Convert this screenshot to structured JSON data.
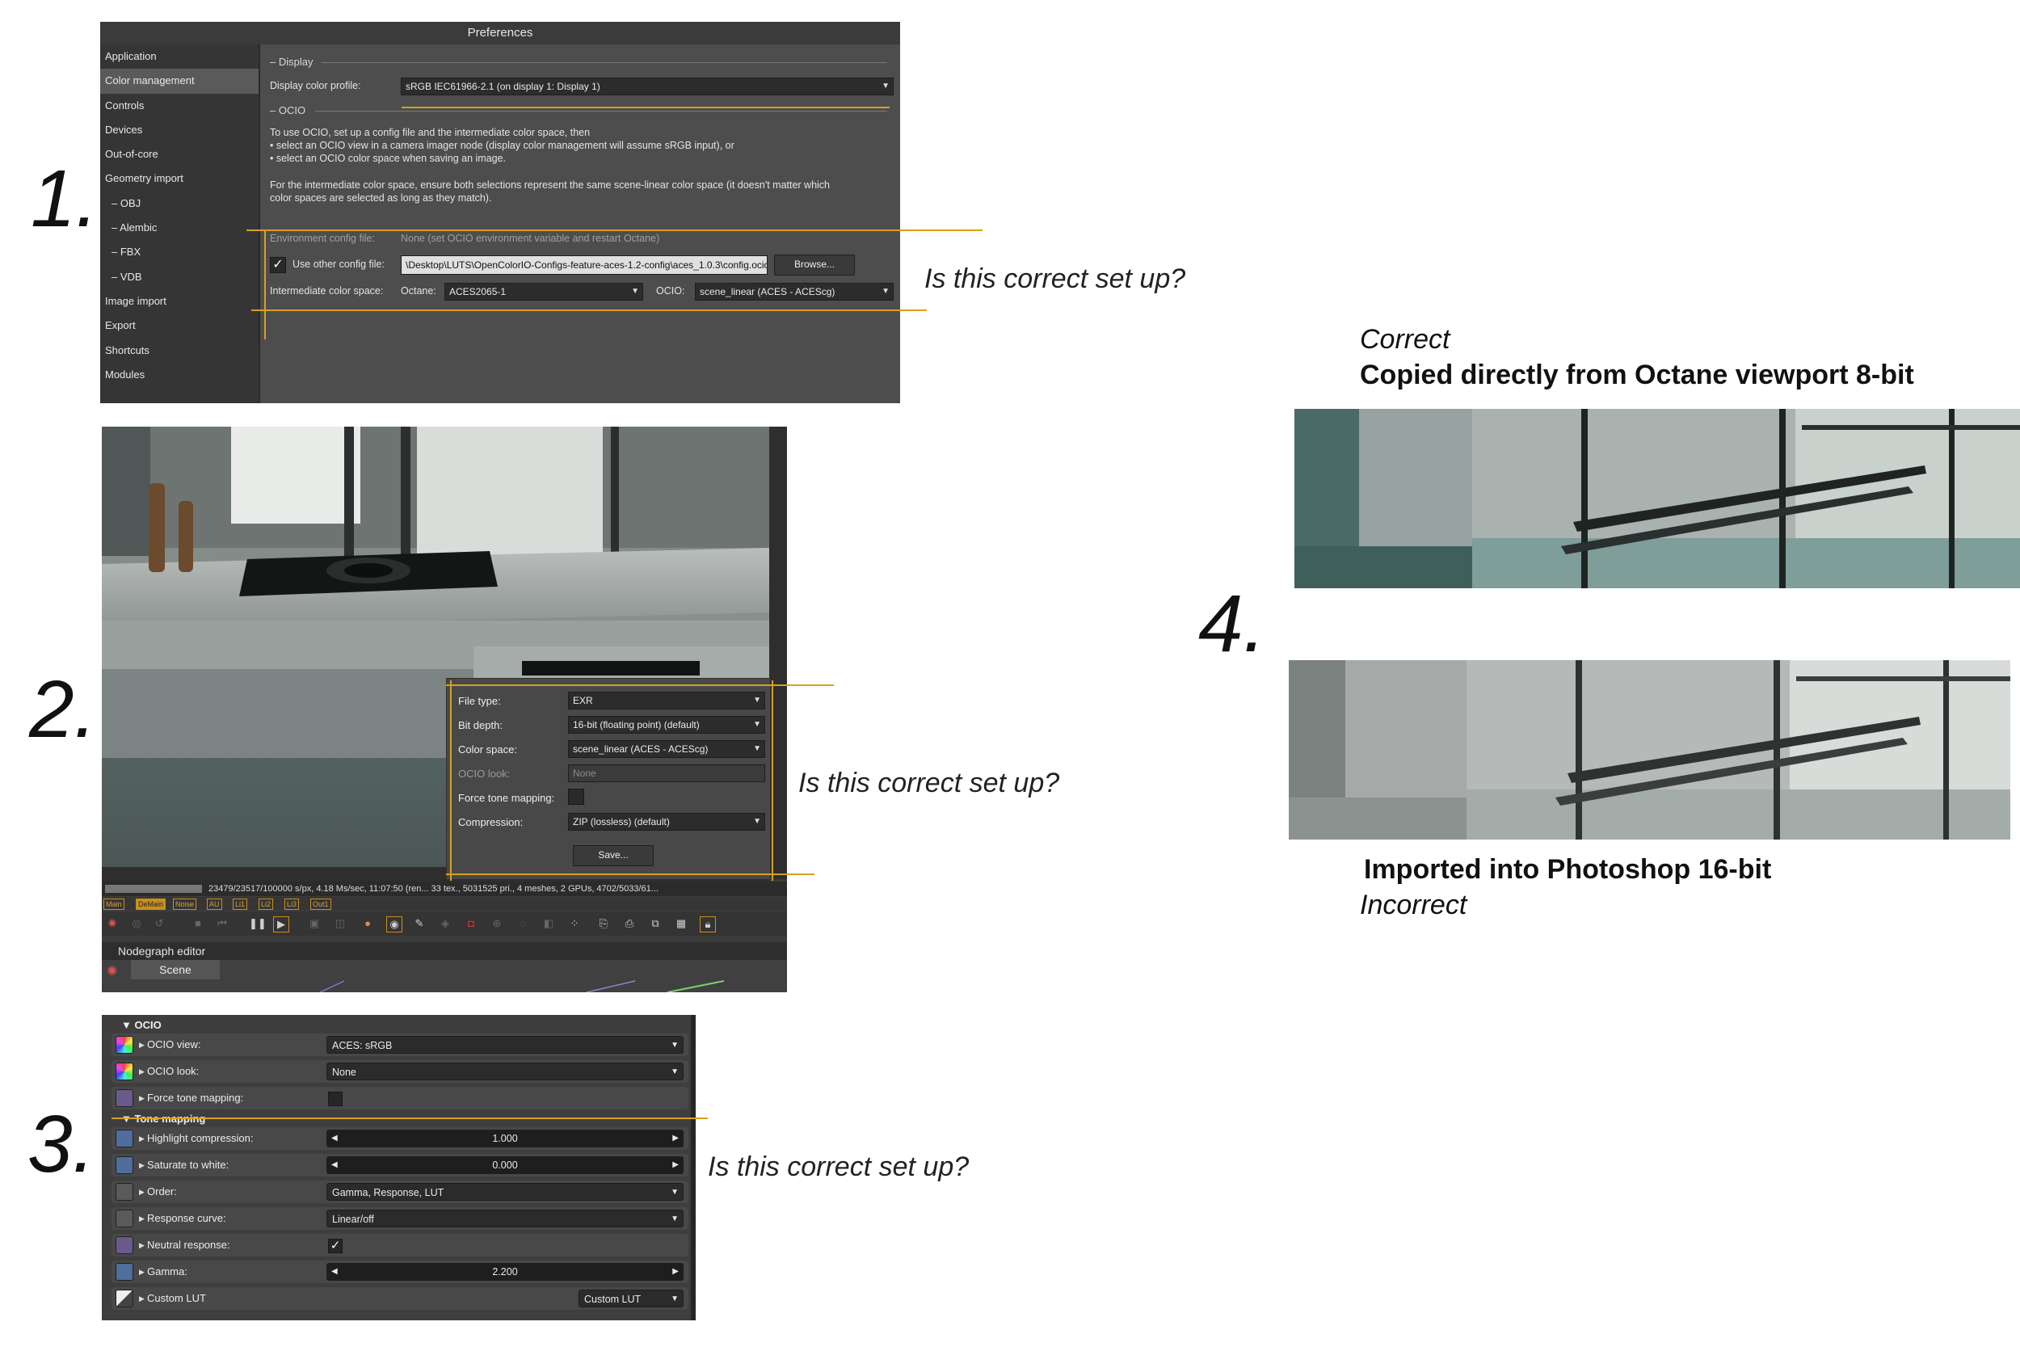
{
  "steps": {
    "s1": "1.",
    "s2": "2.",
    "s3": "3.",
    "s4": "4."
  },
  "question": "Is this correct set up?",
  "colors": {
    "accent_line": "#d5a21d",
    "panel_bg": "#4d4d4d",
    "sidebar_bg": "#353535",
    "field_bg": "#2c2c2c"
  },
  "prefs": {
    "title": "Preferences",
    "sidebar": [
      {
        "label": "Application"
      },
      {
        "label": "Color management"
      },
      {
        "label": "Controls"
      },
      {
        "label": "Devices"
      },
      {
        "label": "Out-of-core"
      },
      {
        "label": "Geometry import"
      },
      {
        "label": "– OBJ"
      },
      {
        "label": "– Alembic"
      },
      {
        "label": "– FBX"
      },
      {
        "label": "– VDB"
      },
      {
        "label": "Image import"
      },
      {
        "label": "Export"
      },
      {
        "label": "Shortcuts"
      },
      {
        "label": "Modules"
      }
    ],
    "display_section": "– Display",
    "display_profile_label": "Display color profile:",
    "display_profile_value": "sRGB IEC61966-2.1 (on display 1: Display 1)",
    "ocio_section": "– OCIO",
    "intro_line1": "To use OCIO, set up a config file and the intermediate color space, then",
    "intro_line2": "• select an OCIO view in a camera imager node (display color management will assume sRGB input), or",
    "intro_line3": "• select an OCIO color space when saving an image.",
    "intro_line4": "For the intermediate color space, ensure both selections represent the same scene-linear color space (it doesn't matter which",
    "intro_line5": "color spaces are selected as long as they match).",
    "env_config_label": "Environment config file:",
    "env_config_value": "None (set OCIO environment variable and restart Octane)",
    "use_other_label": "Use other config file:",
    "use_other_checked": true,
    "config_path": "\\Desktop\\LUTS\\OpenColorIO-Configs-feature-aces-1.2-config\\aces_1.0.3\\config.ocio",
    "browse_label": "Browse...",
    "intermediate_label": "Intermediate color space:",
    "octane_label": "Octane:",
    "octane_value": "ACES2065-1",
    "ocio_label": "OCIO:",
    "ocio_value": "scene_linear (ACES - ACEScg)"
  },
  "export": {
    "file_type_label": "File type:",
    "file_type_value": "EXR",
    "bit_depth_label": "Bit depth:",
    "bit_depth_value": "16-bit (floating point) (default)",
    "color_space_label": "Color space:",
    "color_space_value": "scene_linear (ACES - ACEScg)",
    "ocio_look_label": "OCIO look:",
    "ocio_look_value": "None",
    "force_tone_label": "Force tone mapping:",
    "compression_label": "Compression:",
    "compression_value": "ZIP (lossless) (default)",
    "save_label": "Save...",
    "status_text": "23479/23517/100000 s/px, 4.18 Ms/sec, 11:07:50 (ren...  33 tex., 5031525 pri., 4 meshes, 2 GPUs, 4702/5033/61...",
    "passes": [
      "Main",
      "DeMain",
      "Noise",
      "AU",
      "Li1",
      "Li2",
      "Li3",
      "Out1"
    ],
    "nodegraph_label": "Nodegraph editor",
    "scene_tab": "Scene"
  },
  "imager": {
    "ocio_header": "▼ OCIO",
    "tone_header": "▼ Tone mapping",
    "rows": [
      {
        "label": "OCIO view:",
        "value": "ACES: sRGB",
        "kind": "dropdown",
        "icon": "color-wheel-icon"
      },
      {
        "label": "OCIO look:",
        "value": "None",
        "kind": "dropdown",
        "icon": "color-wheel-icon"
      },
      {
        "label": "Force tone mapping:",
        "value": "",
        "kind": "checkbox",
        "icon": "toggle-icon"
      },
      {
        "label": "Highlight compression:",
        "value": "1.000",
        "kind": "slider",
        "icon": "curve-icon"
      },
      {
        "label": "Saturate to white:",
        "value": "0.000",
        "kind": "slider",
        "icon": "curve-icon"
      },
      {
        "label": "Order:",
        "value": "Gamma, Response, LUT",
        "kind": "dropdown",
        "icon": "order-icon"
      },
      {
        "label": "Response curve:",
        "value": "Linear/off",
        "kind": "dropdown",
        "icon": "order-icon"
      },
      {
        "label": "Neutral response:",
        "value": "✓",
        "kind": "checkbox",
        "icon": "toggle-icon"
      },
      {
        "label": "Gamma:",
        "value": "2.200",
        "kind": "slider",
        "icon": "curve-icon"
      },
      {
        "label": "Custom LUT",
        "value": "Custom LUT",
        "kind": "small-dropdown",
        "icon": "lut-icon"
      }
    ]
  },
  "compare": {
    "correct_label": "Correct",
    "correct_desc": "Copied directly from Octane viewport 8-bit",
    "incorrect_desc": "Imported into Photoshop 16-bit",
    "incorrect_label": "Incorrect"
  }
}
